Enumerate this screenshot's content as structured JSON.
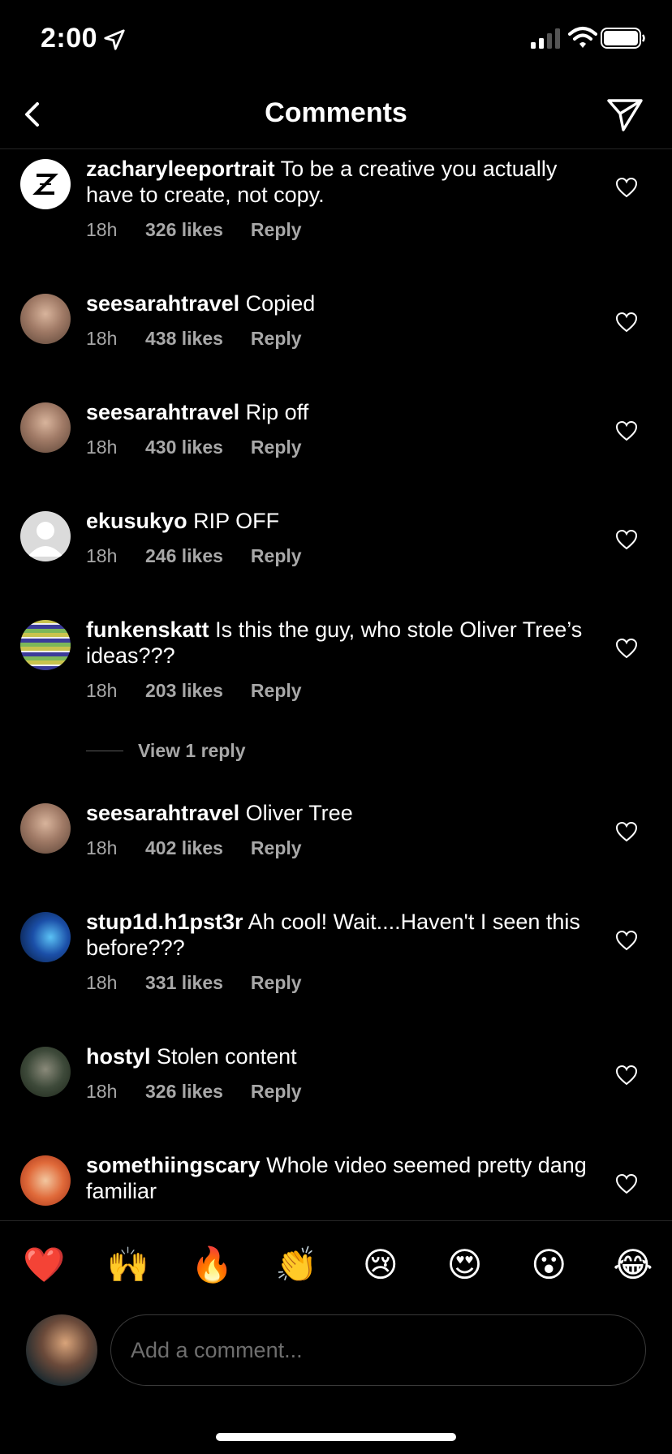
{
  "status_bar": {
    "time": "2:00"
  },
  "header": {
    "title": "Comments",
    "back_icon": "chevron-left-icon",
    "send_icon": "paper-plane-icon"
  },
  "comments": [
    {
      "username": "zacharyleeportrait",
      "text": "To be a creative you actually have to create, not copy.",
      "time": "18h",
      "likes": "326 likes",
      "reply": "Reply"
    },
    {
      "username": "seesarahtravel",
      "text": "Copied",
      "time": "18h",
      "likes": "438 likes",
      "reply": "Reply"
    },
    {
      "username": "seesarahtravel",
      "text": "Rip off",
      "time": "18h",
      "likes": "430 likes",
      "reply": "Reply"
    },
    {
      "username": "ekusukyo",
      "text": "RIP OFF",
      "time": "18h",
      "likes": "246 likes",
      "reply": "Reply"
    },
    {
      "username": "funkenskatt",
      "text": "Is this the guy, who stole Oliver Tree’s ideas???",
      "time": "18h",
      "likes": "203 likes",
      "reply": "Reply",
      "view_replies": "View 1 reply"
    },
    {
      "username": "seesarahtravel",
      "text": "Oliver Tree",
      "time": "18h",
      "likes": "402 likes",
      "reply": "Reply"
    },
    {
      "username": "stup1d.h1pst3r",
      "text": "Ah cool! Wait....Haven't I seen this before???",
      "time": "18h",
      "likes": "331 likes",
      "reply": "Reply"
    },
    {
      "username": "hostyl",
      "text": "Stolen content",
      "time": "18h",
      "likes": "326 likes",
      "reply": "Reply"
    },
    {
      "username": "somethiingscary",
      "text": "Whole video seemed pretty dang familiar"
    }
  ],
  "emoji_bar": [
    "❤️",
    "🙌",
    "🔥",
    "👏",
    "😢",
    "😍",
    "😮",
    "😂"
  ],
  "composer": {
    "placeholder": "Add a comment..."
  },
  "colors": {
    "background": "#000000",
    "secondary_text": "#a8a8a8",
    "divider": "#262626"
  }
}
